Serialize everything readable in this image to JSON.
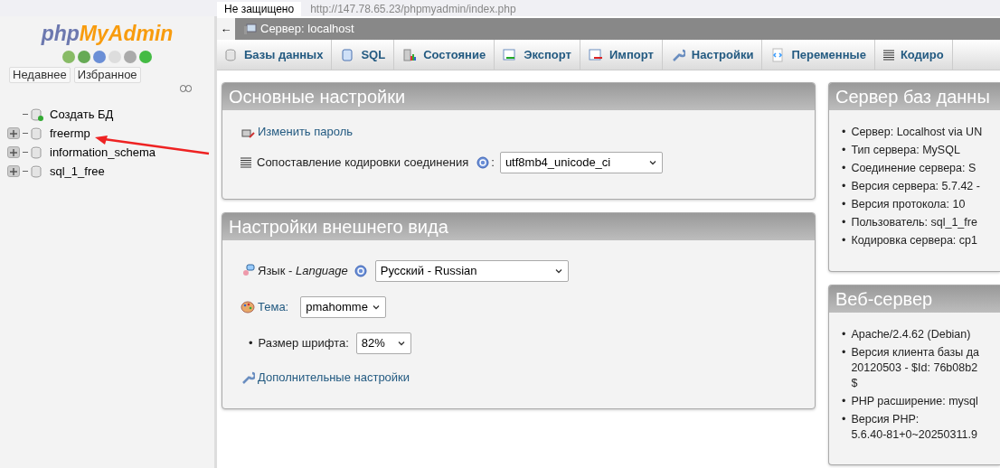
{
  "browser": {
    "security": "Не защищено",
    "url": "http://147.78.65.23/phpmyadmin/index.php"
  },
  "logo": {
    "part_1": "php",
    "part_2": "MyAdmin"
  },
  "sidebar": {
    "tabs": [
      {
        "label": "Недавнее"
      },
      {
        "label": "Избранное"
      }
    ],
    "tree": [
      {
        "label": "Создать БД",
        "kind": "new"
      },
      {
        "label": "freermp",
        "kind": "db"
      },
      {
        "label": "information_schema",
        "kind": "db"
      },
      {
        "label": "sql_1_free",
        "kind": "db"
      }
    ]
  },
  "breadcrumb": {
    "back": "←",
    "server": "Сервер: localhost"
  },
  "tabs": [
    {
      "label": "Базы данных"
    },
    {
      "label": "SQL"
    },
    {
      "label": "Состояние"
    },
    {
      "label": "Экспорт"
    },
    {
      "label": "Импорт"
    },
    {
      "label": "Настройки"
    },
    {
      "label": "Переменные"
    },
    {
      "label": "Кодиро"
    }
  ],
  "general": {
    "title": "Основные настройки",
    "change_password": "Изменить пароль",
    "collation_label": "Сопоставление кодировки соединения",
    "colon": ":",
    "collation_value": "utf8mb4_unicode_ci"
  },
  "appearance": {
    "title": "Настройки внешнего вида",
    "language_label": "Язык - *Language*",
    "language_value": "Русский - Russian",
    "theme_label": "Тема:",
    "theme_value": "pmahomme",
    "font_bullet": "•",
    "font_label": "Размер шрифта:",
    "font_value": "82%",
    "more_settings": "Дополнительные настройки"
  },
  "bullet": "•",
  "db_server": {
    "title": "Сервер баз данны",
    "items": [
      {
        "lines": [
          "Сервер: Localhost via UN"
        ]
      },
      {
        "lines": [
          "Тип сервера: MySQL"
        ]
      },
      {
        "lines": [
          "Соединение сервера: S"
        ]
      },
      {
        "lines": [
          "Версия сервера: 5.7.42 -"
        ]
      },
      {
        "lines": [
          "Версия протокола: 10"
        ]
      },
      {
        "lines": [
          "Пользователь: sql_1_fre"
        ]
      },
      {
        "lines": [
          "Кодировка сервера: cp1"
        ]
      }
    ]
  },
  "web_server": {
    "title": "Веб-сервер",
    "items": [
      {
        "lines": [
          "Apache/2.4.62 (Debian)"
        ]
      },
      {
        "lines": [
          "Версия клиента базы да",
          "20120503 - $Id: 76b08b2",
          "$"
        ]
      },
      {
        "lines": [
          "PHP расширение: mysql"
        ]
      },
      {
        "lines": [
          "Версия PHP:",
          "5.6.40-81+0~20250311.9"
        ]
      }
    ]
  }
}
